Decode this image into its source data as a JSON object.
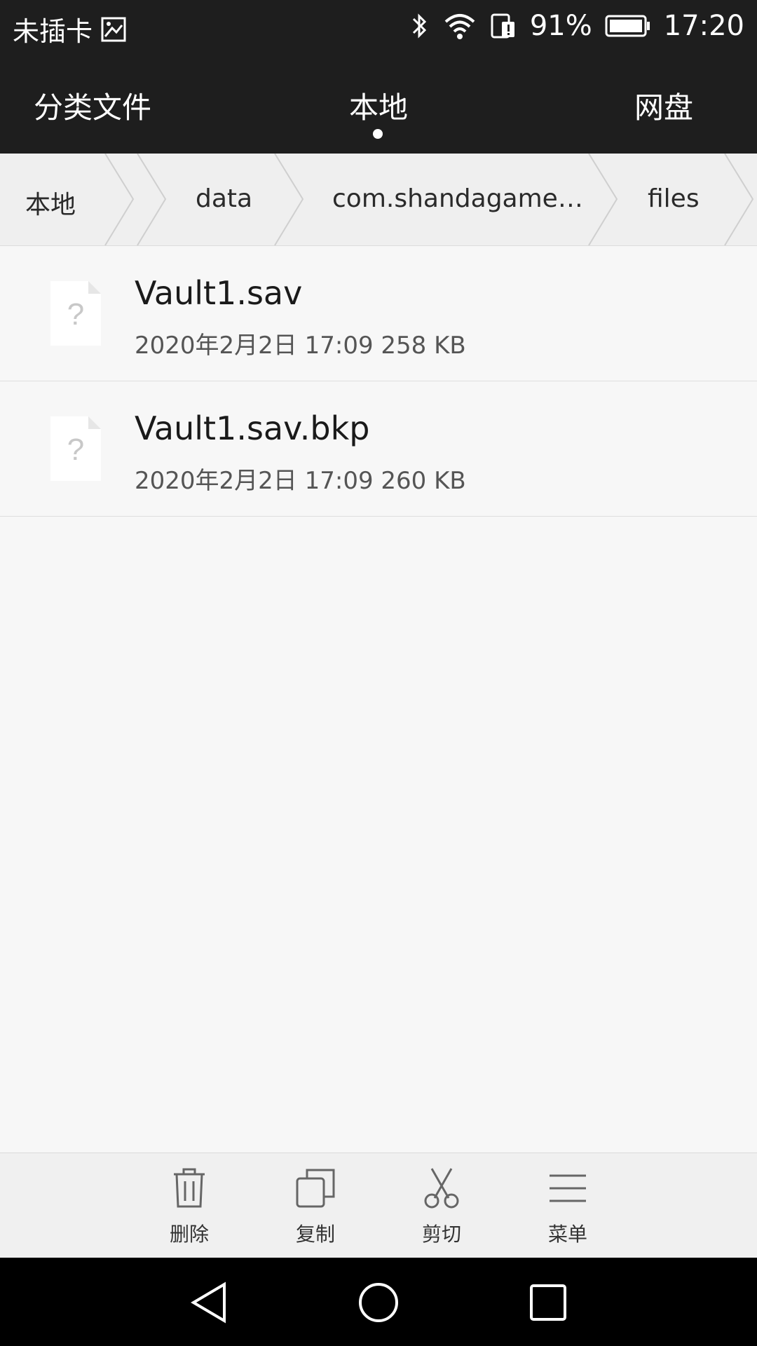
{
  "status_bar": {
    "sim_text": "未插卡",
    "battery_percent": "91%",
    "time": "17:20"
  },
  "tabs": {
    "categories": "分类文件",
    "local": "本地",
    "cloud": "网盘"
  },
  "breadcrumb": {
    "root": "本地",
    "level1": "data",
    "level2": "com.shandagame…",
    "level3": "files"
  },
  "files": [
    {
      "name": "Vault1.sav",
      "meta": "2020年2月2日 17:09 258 KB"
    },
    {
      "name": "Vault1.sav.bkp",
      "meta": "2020年2月2日 17:09 260 KB"
    }
  ],
  "actions": {
    "delete": "删除",
    "copy": "复制",
    "cut": "剪切",
    "menu": "菜单"
  },
  "icons": {
    "file_unknown_glyph": "?"
  }
}
